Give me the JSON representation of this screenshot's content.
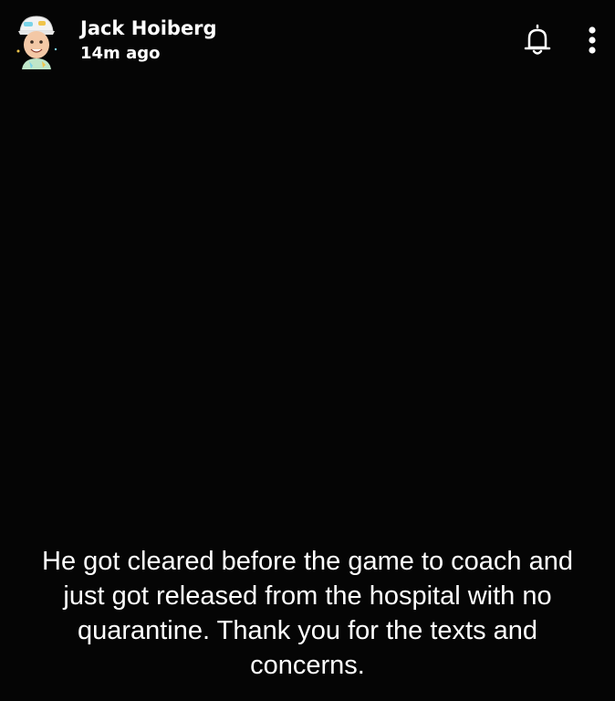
{
  "header": {
    "username": "Jack Hoiberg",
    "timestamp": "14m ago",
    "avatar_icon": "bitmoji-avatar-icon",
    "notify_icon": "bell-icon",
    "menu_icon": "more-vertical-icon"
  },
  "caption": {
    "lines": [
      "He got cleared before the game to coach and",
      "just got released from the hospital with no",
      "quarantine. Thank you for the texts and",
      "concerns."
    ]
  },
  "colors": {
    "background": "#000000",
    "text": "#ffffff"
  }
}
